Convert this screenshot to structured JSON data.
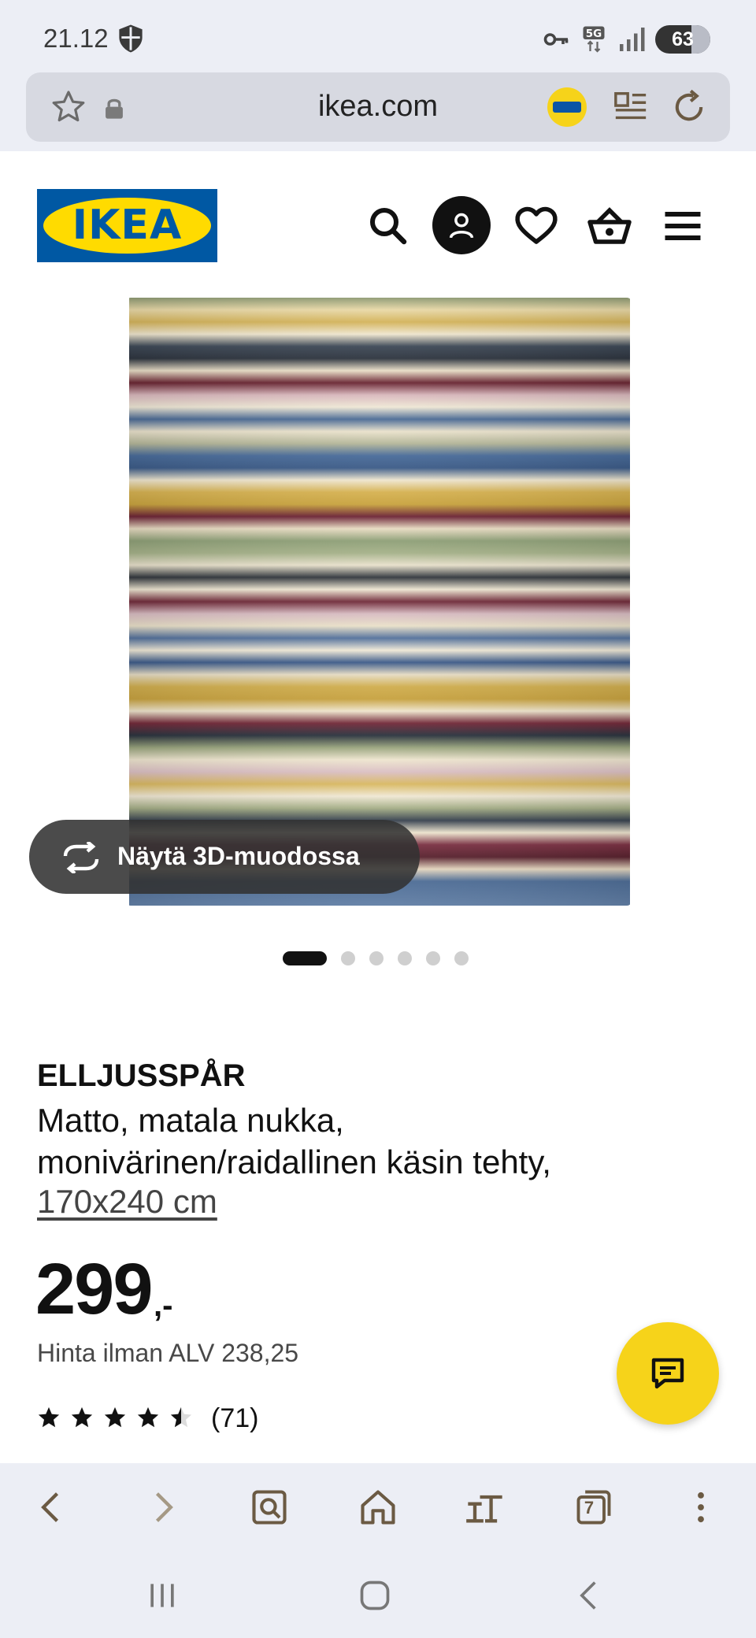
{
  "status_bar": {
    "time": "21.12",
    "battery": "63",
    "icons": [
      "shield-icon",
      "key-icon",
      "5g-icon",
      "signal-icon",
      "battery-icon"
    ]
  },
  "browser": {
    "url": "ikea.com",
    "icons": [
      "star-icon",
      "lock-icon",
      "ikea-extension-icon",
      "reader-mode-icon",
      "reload-icon"
    ]
  },
  "header": {
    "logo_text": "IKEA",
    "icons": [
      "search-icon",
      "profile-icon",
      "heart-icon",
      "cart-icon",
      "menu-icon"
    ]
  },
  "gallery": {
    "view_3d_label": "Näytä 3D-muodossa",
    "image_count": 6,
    "active_index": 0
  },
  "product": {
    "name": "ELLJUSSPÅR",
    "description": "Matto, matala nukka, monivärinen/raidallinen käsin tehty,",
    "size": "170x240 cm",
    "price": "299",
    "price_suffix": ",-",
    "price_vat": "Hinta ilman ALV 238,25",
    "rating": 4.5,
    "rating_max": 5,
    "review_count": "(71)"
  },
  "colors": {
    "ikea_blue": "#0058a3",
    "ikea_yellow": "#ffdb00",
    "chat_yellow": "#f6d31a",
    "browser_chrome": "#eceef5"
  },
  "bottom_toolbar": {
    "tab_count": "7",
    "icons": [
      "back-icon",
      "forward-icon",
      "search-page-icon",
      "home-icon",
      "text-size-icon",
      "tabs-icon",
      "more-icon"
    ]
  }
}
